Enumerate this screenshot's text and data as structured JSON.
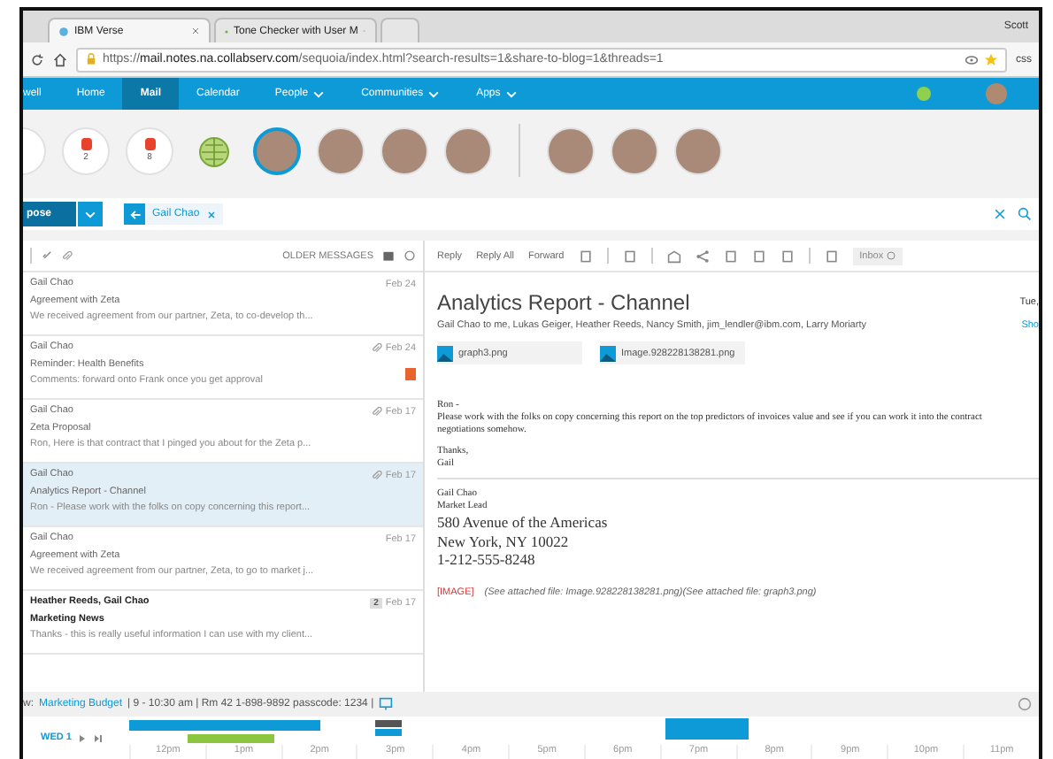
{
  "browser": {
    "tabs": [
      {
        "title": "IBM Verse",
        "selected": true
      },
      {
        "title": "Tone Checker with User M",
        "selected": false
      }
    ],
    "profile": "Scott",
    "url_scheme": "https://",
    "url_host": "mail.notes.na.collabserv.com",
    "url_path": "/sequoia/index.html?search-results=1&share-to-blog=1&threads=1",
    "extension": "css"
  },
  "nav": {
    "items": [
      {
        "label": "well",
        "selected": false,
        "dropdown": false
      },
      {
        "label": "Home",
        "selected": false,
        "dropdown": false
      },
      {
        "label": "Mail",
        "selected": true,
        "dropdown": false
      },
      {
        "label": "Calendar",
        "selected": false,
        "dropdown": false
      },
      {
        "label": "People",
        "selected": false,
        "dropdown": true
      },
      {
        "label": "Communities",
        "selected": false,
        "dropdown": true
      },
      {
        "label": "Apps",
        "selected": false,
        "dropdown": true
      }
    ]
  },
  "bubbles": [
    {
      "kind": "partial"
    },
    {
      "kind": "count",
      "count": "2",
      "color": "#e8412c"
    },
    {
      "kind": "count",
      "count": "8",
      "color": "#e8412c"
    },
    {
      "kind": "logo"
    },
    {
      "kind": "person",
      "selected": true
    },
    {
      "kind": "person",
      "selected": false
    },
    {
      "kind": "person",
      "selected": false
    },
    {
      "kind": "person",
      "selected": false
    },
    {
      "kind": "divider"
    },
    {
      "kind": "person",
      "selected": false
    },
    {
      "kind": "person",
      "selected": false
    },
    {
      "kind": "person",
      "selected": false
    }
  ],
  "compose": {
    "label": "pose",
    "filter": "Gail Chao"
  },
  "list": {
    "older": "OLDER MESSAGES",
    "messages": [
      {
        "from": "Gail Chao",
        "subject": "Agreement with Zeta",
        "preview": "We received agreement from our partner, Zeta, to co-develop th...",
        "date": "Feb 24",
        "attachment": false,
        "unread": false,
        "selected": false,
        "flagged": false
      },
      {
        "from": "Gail Chao",
        "subject": "Reminder: Health Benefits",
        "preview": "Comments: forward onto Frank once you get approval",
        "date": "Feb 24",
        "attachment": true,
        "unread": false,
        "selected": false,
        "flagged": true
      },
      {
        "from": "Gail Chao",
        "subject": "Zeta Proposal",
        "preview": "Ron, Here is that contract that I pinged you about for the Zeta p...",
        "date": "Feb 17",
        "attachment": true,
        "unread": false,
        "selected": false,
        "flagged": false
      },
      {
        "from": "Gail Chao",
        "subject": "Analytics Report - Channel",
        "preview": "Ron - Please work with the folks on copy concerning this report...",
        "date": "Feb 17",
        "attachment": true,
        "unread": false,
        "selected": true,
        "flagged": false
      },
      {
        "from": "Gail Chao",
        "subject": "Agreement with Zeta",
        "preview": "We received agreement from our partner, Zeta, to go to market j...",
        "date": "Feb 17",
        "attachment": false,
        "unread": false,
        "selected": false,
        "flagged": false
      },
      {
        "from": "Heather Reeds, Gail Chao",
        "subject": "Marketing News",
        "preview": "Thanks - this is really useful information I can use with my client...",
        "date": "Feb 17",
        "attachment": false,
        "unread": true,
        "selected": false,
        "flagged": false,
        "count": "2"
      }
    ]
  },
  "reading": {
    "actions": [
      "Reply",
      "Reply All",
      "Forward"
    ],
    "folder": "Inbox",
    "subject": "Analytics Report - Channel",
    "date": "Tue,",
    "show": "Sho",
    "recipients": "Gail Chao to me, Lukas Geiger, Heather Reeds, Nancy Smith, jim_lendler@ibm.com, Larry Moriarty",
    "attachments": [
      "graph3.png",
      "Image.928228138281.png"
    ],
    "greeting": "Ron -",
    "body": "Please work with the folks on copy concerning this report on the top predictors of invoices value and see if you can work it into the contract negotiations somehow.",
    "closing": "Thanks,",
    "signoff": "Gail",
    "signature_small": [
      "Gail Chao",
      "Market Lead"
    ],
    "signature_large": [
      "580 Avenue of the Americas",
      "New York, NY  10022",
      "1-212-555-8248"
    ],
    "image_tag": "[IMAGE]",
    "image_note": "(See attached file: Image.928228138281.png)(See attached file: graph3.png)"
  },
  "meeting": {
    "prefix": "w:",
    "title": "Marketing Budget",
    "details": "| 9 - 10:30 am | Rm 42 1-898-9892 passcode: 1234 |"
  },
  "timeline": {
    "day": "WED 1",
    "hours": [
      "12pm",
      "1pm",
      "2pm",
      "3pm",
      "4pm",
      "5pm",
      "6pm",
      "7pm",
      "8pm",
      "9pm",
      "10pm",
      "11pm"
    ]
  }
}
